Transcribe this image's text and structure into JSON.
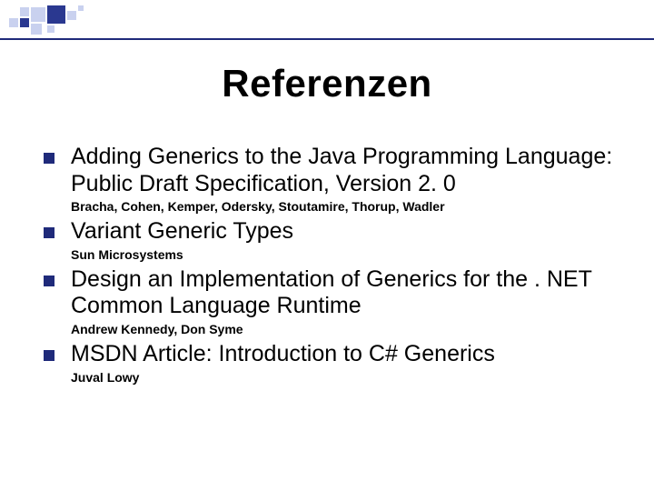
{
  "title": "Referenzen",
  "items": [
    {
      "text": "Adding Generics to the Java Programming Language: Public Draft Specification, Version 2. 0",
      "sub": "Bracha, Cohen, Kemper, Odersky, Stoutamire, Thorup, Wadler"
    },
    {
      "text": "Variant Generic Types",
      "sub": "Sun Microsystems"
    },
    {
      "text": "Design an Implementation of Generics for the . NET Common Language Runtime",
      "sub": "Andrew Kennedy, Don Syme"
    },
    {
      "text": "MSDN Article: Introduction to C# Generics",
      "sub": "Juval Lowy"
    }
  ]
}
